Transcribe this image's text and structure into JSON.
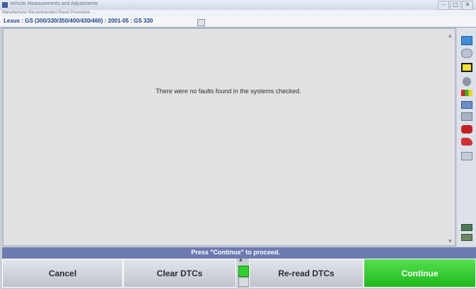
{
  "window": {
    "title": "Vehicle Measurements and Adjustments",
    "controls": [
      "–",
      "□",
      "✕"
    ]
  },
  "subtitle": "Manufacturer Recommended Reset Procedure",
  "vehicle": {
    "label": "Lexus : GS (300/330/350/400/430/460) : 2001-05 : GS 330"
  },
  "main": {
    "message": "There were no faults found in the systems checked."
  },
  "status": {
    "prompt": "Press \"Continue\" to proceed."
  },
  "buttons": {
    "cancel": "Cancel",
    "clear_dtcs": "Clear DTCs",
    "reread_dtcs": "Re-read DTCs",
    "continue": "Continue"
  },
  "right_toolbar": {
    "icons": [
      "help-icon",
      "tools-icon",
      "pencil-icon",
      "tire-icon",
      "color-bars-icon",
      "vehicle-icon",
      "camera-icon",
      "car-red-icon",
      "car-side-icon",
      "printer-icon",
      "gauge-icon",
      "ruler-icon"
    ]
  },
  "colors": {
    "status_bar": "#6d7bb1",
    "continue_green": "#2fc42c",
    "header_blue": "#1c3f8c"
  }
}
